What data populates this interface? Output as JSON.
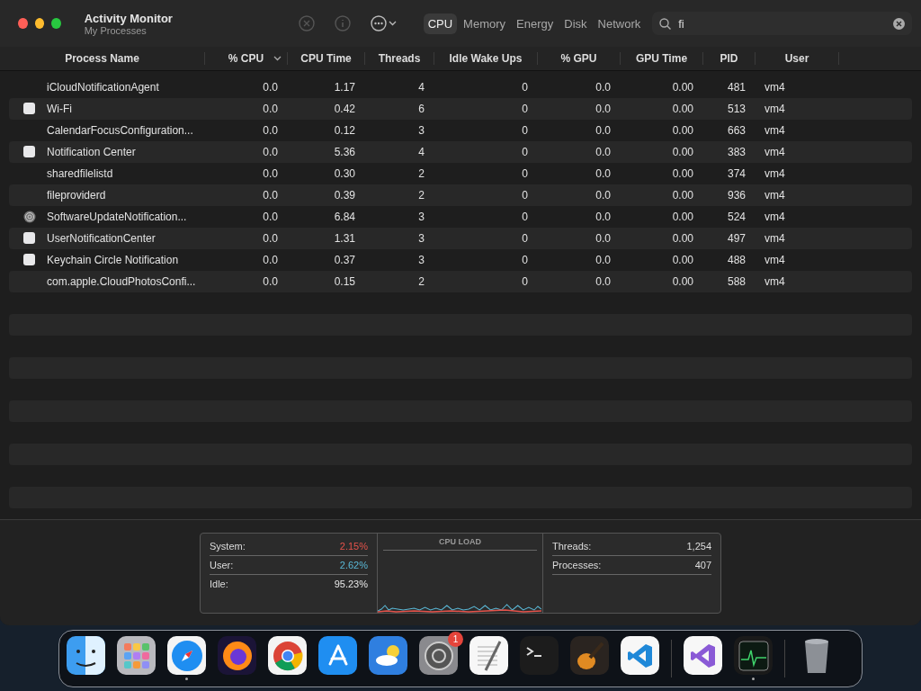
{
  "window": {
    "title": "Activity Monitor",
    "subtitle": "My Processes"
  },
  "toolbar": {
    "buttons": [
      {
        "kind": "stop",
        "disabled": true
      },
      {
        "kind": "info",
        "disabled": true
      },
      {
        "kind": "more",
        "disabled": false
      }
    ]
  },
  "tabs": [
    {
      "label": "CPU",
      "selected": true
    },
    {
      "label": "Memory",
      "selected": false
    },
    {
      "label": "Energy",
      "selected": false
    },
    {
      "label": "Disk",
      "selected": false
    },
    {
      "label": "Network",
      "selected": false
    }
  ],
  "search": {
    "value": "fi"
  },
  "table": {
    "columns": [
      {
        "label": "Process Name",
        "sorted": false
      },
      {
        "label": "% CPU",
        "sorted": true
      },
      {
        "label": "CPU Time",
        "sorted": false
      },
      {
        "label": "Threads",
        "sorted": false
      },
      {
        "label": "Idle Wake Ups",
        "sorted": false
      },
      {
        "label": "% GPU",
        "sorted": false
      },
      {
        "label": "GPU Time",
        "sorted": false
      },
      {
        "label": "PID",
        "sorted": false
      },
      {
        "label": "User",
        "sorted": false
      }
    ],
    "rows": [
      {
        "kind": "none",
        "cells": [
          "iCloudNotificationAgent",
          "0.0",
          "1.17",
          "4",
          "0",
          "0.0",
          "0.00",
          "481",
          "vm4"
        ]
      },
      {
        "kind": "blank",
        "cells": [
          "Wi-Fi",
          "0.0",
          "0.42",
          "6",
          "0",
          "0.0",
          "0.00",
          "513",
          "vm4"
        ]
      },
      {
        "kind": "none",
        "cells": [
          "CalendarFocusConfiguration...",
          "0.0",
          "0.12",
          "3",
          "0",
          "0.0",
          "0.00",
          "663",
          "vm4"
        ]
      },
      {
        "kind": "blank",
        "cells": [
          "Notification Center",
          "0.0",
          "5.36",
          "4",
          "0",
          "0.0",
          "0.00",
          "383",
          "vm4"
        ]
      },
      {
        "kind": "none",
        "cells": [
          "sharedfilelistd",
          "0.0",
          "0.30",
          "2",
          "0",
          "0.0",
          "0.00",
          "374",
          "vm4"
        ]
      },
      {
        "kind": "none",
        "cells": [
          "fileproviderd",
          "0.0",
          "0.39",
          "2",
          "0",
          "0.0",
          "0.00",
          "936",
          "vm4"
        ]
      },
      {
        "kind": "gear",
        "cells": [
          "SoftwareUpdateNotification...",
          "0.0",
          "6.84",
          "3",
          "0",
          "0.0",
          "0.00",
          "524",
          "vm4"
        ]
      },
      {
        "kind": "blank",
        "cells": [
          "UserNotificationCenter",
          "0.0",
          "1.31",
          "3",
          "0",
          "0.0",
          "0.00",
          "497",
          "vm4"
        ]
      },
      {
        "kind": "blank",
        "cells": [
          "Keychain Circle Notification",
          "0.0",
          "0.37",
          "3",
          "0",
          "0.0",
          "0.00",
          "488",
          "vm4"
        ]
      },
      {
        "kind": "none",
        "cells": [
          "com.apple.CloudPhotosConfi...",
          "0.0",
          "0.15",
          "2",
          "0",
          "0.0",
          "0.00",
          "588",
          "vm4"
        ]
      }
    ]
  },
  "cpu_stats": [
    {
      "label": "System:",
      "value": "2.15%",
      "color": "#e5534b"
    },
    {
      "label": "User:",
      "value": "2.62%",
      "color": "#5ab8d6"
    },
    {
      "label": "Idle:",
      "value": "95.23%",
      "color": "#e8e8e8"
    }
  ],
  "cpu_load": {
    "title": "CPU LOAD"
  },
  "counts": [
    {
      "label": "Threads:",
      "value": "1,254"
    },
    {
      "label": "Processes:",
      "value": "407"
    }
  ],
  "dock": {
    "apps": [
      {
        "kind": "finder",
        "running": false
      },
      {
        "kind": "launchpad",
        "running": false
      },
      {
        "kind": "safari",
        "running": true
      },
      {
        "kind": "firefox",
        "running": false
      },
      {
        "kind": "chrome",
        "running": false
      },
      {
        "kind": "appstore",
        "running": false
      },
      {
        "kind": "weather",
        "running": false
      },
      {
        "kind": "settings",
        "running": false,
        "badge": "1"
      },
      {
        "kind": "textedit",
        "running": false
      },
      {
        "kind": "terminal",
        "running": false
      },
      {
        "kind": "garageband",
        "running": false
      },
      {
        "kind": "vscode",
        "running": false
      },
      {
        "kind": "divider"
      },
      {
        "kind": "vstudio",
        "running": false
      },
      {
        "kind": "activity",
        "running": true
      },
      {
        "kind": "divider"
      },
      {
        "kind": "trash",
        "running": false
      }
    ]
  }
}
